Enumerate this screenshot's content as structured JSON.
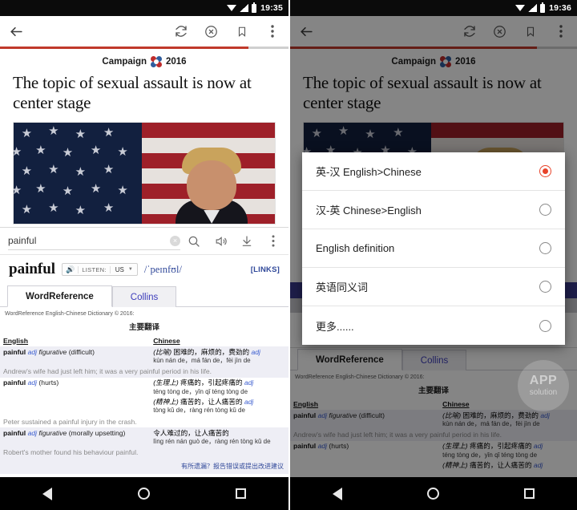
{
  "left": {
    "status": {
      "time": "19:35",
      "icons": [
        "wifi-icon",
        "signal-icon",
        "battery-icon"
      ]
    },
    "toolbar": {
      "back_label": "←",
      "icons": [
        "refresh-icon",
        "stop-icon",
        "bookmark-icon",
        "overflow-menu-icon"
      ]
    },
    "article": {
      "kicker": "Campaign",
      "kicker_year": "2016",
      "headline": "The topic of sexual assault is now at center stage"
    },
    "dictionary": {
      "search_value": "painful",
      "search_placeholder": "Search",
      "clear_label": "×",
      "icons": [
        "search-icon",
        "speaker-icon",
        "download-icon",
        "overflow-menu-icon"
      ],
      "headword": "painful",
      "listen_label": "LISTEN:",
      "accent": "US",
      "ipa": "/ˈpeɪnfʊl/",
      "links_label": "[LINKS]",
      "tabs": [
        {
          "label": "WordReference",
          "active": true
        },
        {
          "label": "Collins",
          "active": false
        }
      ],
      "copyright": "WordReference English-Chinese Dictionary © 2016:",
      "section_title": "主要翻译",
      "col_english": "English",
      "col_chinese": "Chinese",
      "entries": [
        {
          "term": "painful",
          "pos": "adj",
          "fig": "figurative",
          "sense": "(difficult)",
          "cn_paren": "(比喻)",
          "cn_gloss": "困难的，麻烦的，费劲的",
          "cn_pos": "adj",
          "pinyin": "kùn nán de，má fán de，fèi jìn de",
          "example": "Andrew's wife had just left him; it was a very painful period in his life."
        },
        {
          "term": "painful",
          "pos": "adj",
          "fig": "",
          "sense": "(hurts)",
          "cn_paren": "(生理上)",
          "cn_gloss": "疼痛的，引起疼痛的",
          "cn_pos": "adj",
          "pinyin": "téng tòng de，yǐn qǐ téng tòng de",
          "cn_paren2": "(精神上)",
          "cn_gloss2": "痛苦的，让人痛苦的",
          "pinyin2": "tòng kǔ de，ràng rén tòng kǔ de",
          "example": "Peter sustained a painful injury in the crash."
        },
        {
          "term": "painful",
          "pos": "adj",
          "fig": "figurative",
          "sense": "(morally upsetting)",
          "cn_paren": "",
          "cn_gloss": "令人难过的，让人痛苦的",
          "cn_pos": "",
          "pinyin": "lìng rén nán guò de，ràng rén tòng kǔ de",
          "example": "Robert's mother found his behaviour painful."
        }
      ],
      "footer_link": "有所遗漏？报告错误或提出改进建议"
    },
    "navbar": {
      "back": "back-nav",
      "home": "home-nav",
      "recents": "recents-nav"
    }
  },
  "right": {
    "status": {
      "time": "19:36"
    },
    "dialog": {
      "options": [
        {
          "label": "英-汉 English>Chinese",
          "selected": true
        },
        {
          "label": "汉-英 Chinese>English",
          "selected": false
        },
        {
          "label": "English definition",
          "selected": false
        },
        {
          "label": "英语同义词",
          "selected": false
        },
        {
          "label": "更多......",
          "selected": false
        }
      ]
    },
    "watermark": {
      "line1": "APP",
      "line2": "solution"
    }
  },
  "colors": {
    "accent_red": "#c0392b",
    "radio_selected": "#e8432a",
    "link_blue": "#31499a",
    "tab_blue": "#3d3dbb",
    "row_alt": "#eeeef5"
  }
}
